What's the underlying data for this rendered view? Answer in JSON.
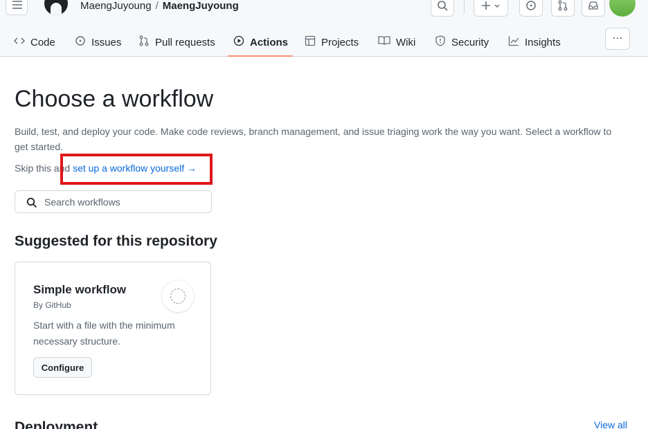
{
  "header": {
    "owner": "MaengJuyoung",
    "separator": "/",
    "repo": "MaengJuyoung",
    "plus_label": "+"
  },
  "nav": {
    "tabs": [
      {
        "label": "Code",
        "icon": "code-icon"
      },
      {
        "label": "Issues",
        "icon": "issue-icon"
      },
      {
        "label": "Pull requests",
        "icon": "pull-request-icon"
      },
      {
        "label": "Actions",
        "icon": "play-icon",
        "active": true
      },
      {
        "label": "Projects",
        "icon": "table-icon"
      },
      {
        "label": "Wiki",
        "icon": "book-icon"
      },
      {
        "label": "Security",
        "icon": "shield-icon"
      },
      {
        "label": "Insights",
        "icon": "graph-icon"
      }
    ],
    "more_label": "···"
  },
  "main": {
    "title": "Choose a workflow",
    "description": "Build, test, and deploy your code. Make code reviews, branch management, and issue triaging work the way you want. Select a workflow to get started.",
    "skip_prefix": "Skip this and ",
    "skip_link": "set up a workflow yourself",
    "skip_arrow": "→",
    "search_placeholder": "Search workflows",
    "search_value": ""
  },
  "suggested": {
    "heading": "Suggested for this repository",
    "card": {
      "title": "Simple workflow",
      "by": "By GitHub",
      "description": "Start with a file with the minimum necessary structure.",
      "button": "Configure"
    }
  },
  "deployment": {
    "heading": "Deployment",
    "view_all": "View all"
  },
  "colors": {
    "accent": "#0969da",
    "highlight": "#e0161b",
    "tab_underline": "#fd8c73"
  }
}
